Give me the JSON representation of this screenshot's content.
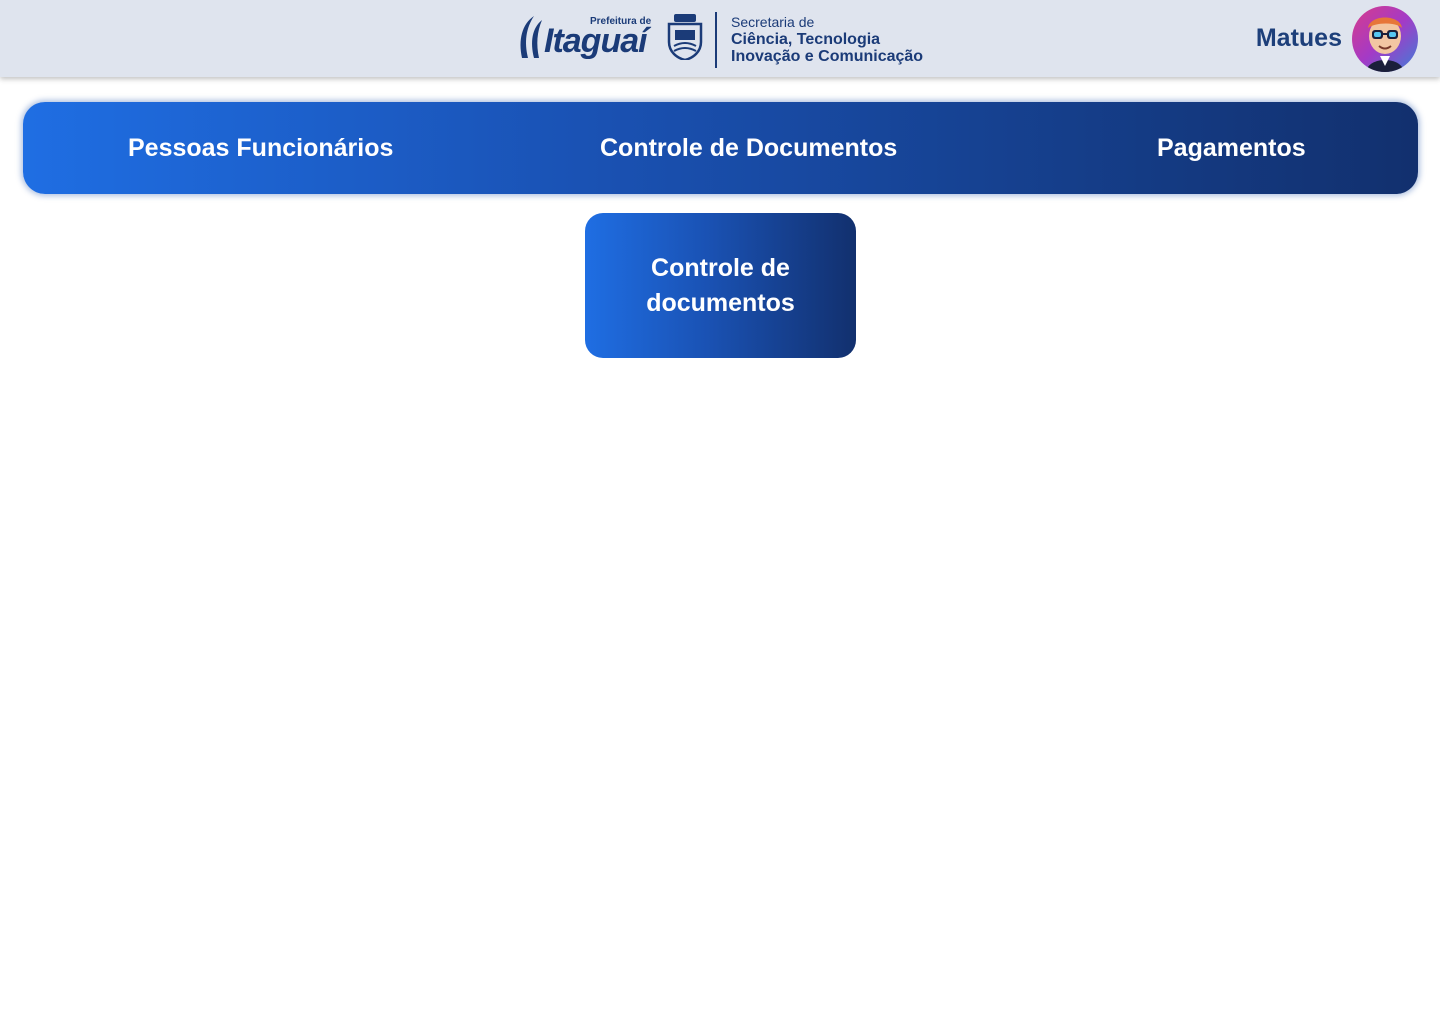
{
  "header": {
    "logo": {
      "prefeitura_small": "Prefeitura de",
      "city_name": "Itaguaí",
      "secretaria_line1": "Secretaria de",
      "secretaria_line2": "Ciência, Tecnologia",
      "secretaria_line3": "Inovação e Comunicação"
    },
    "user": {
      "name": "Matues"
    }
  },
  "nav": {
    "items": [
      {
        "label": "Pessoas Funcionários"
      },
      {
        "label": "Controle de Documentos"
      },
      {
        "label": "Pagamentos"
      }
    ]
  },
  "main": {
    "card": {
      "label": "Controle de documentos"
    }
  },
  "colors": {
    "header_bg": "#dfe4ee",
    "brand_navy": "#1b3b78",
    "gradient_start": "#1f6ee3",
    "gradient_end": "#12306e",
    "text_on_brand": "#ffffff"
  }
}
